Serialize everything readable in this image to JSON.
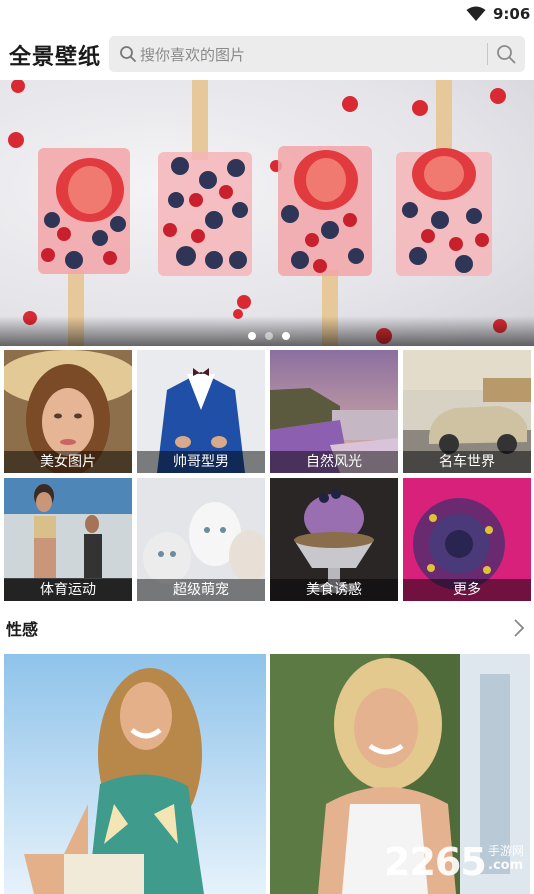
{
  "status_bar": {
    "time": "9:06"
  },
  "header": {
    "app_title": "全景壁纸",
    "search_placeholder": "搜你喜欢的图片"
  },
  "banner": {
    "page_count": 3,
    "active_page": 2
  },
  "categories": [
    {
      "label": "美女图片"
    },
    {
      "label": "帅哥型男"
    },
    {
      "label": "自然风光"
    },
    {
      "label": "名车世界"
    },
    {
      "label": "体育运动"
    },
    {
      "label": "超级萌宠"
    },
    {
      "label": "美食诱惑"
    },
    {
      "label": "更多"
    }
  ],
  "section": {
    "title": "性感"
  },
  "watermark": {
    "number": "2265",
    "site_cn": "手游网",
    "site_com": ".com"
  },
  "colors": {
    "accent_berry": "#d92a34",
    "caption_bg": "rgba(0,0,0,0.48)"
  }
}
